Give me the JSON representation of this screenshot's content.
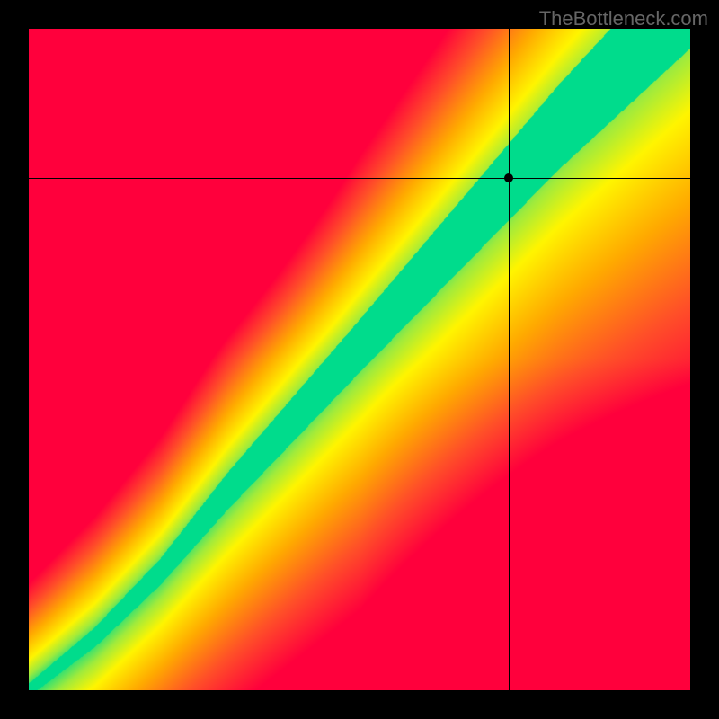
{
  "watermark": "TheBottleneck.com",
  "chart_data": {
    "type": "heatmap",
    "title": "",
    "xlabel": "",
    "ylabel": "",
    "xlim": [
      0,
      1
    ],
    "ylim": [
      0,
      1
    ],
    "colormap": "red-yellow-green (bottleneck)",
    "crosshair": {
      "x": 0.725,
      "y": 0.775
    },
    "marker": {
      "x": 0.725,
      "y": 0.775
    },
    "description": "2D heatmap where a curved green ridge (optimal / 0% bottleneck) runs diagonally from bottom-left to top-right, widening toward the top; red at far off-ridge regions, yellow transitional.",
    "ridge_samples": [
      {
        "x": 0.0,
        "y_center": 0.0,
        "half_width": 0.01
      },
      {
        "x": 0.1,
        "y_center": 0.08,
        "half_width": 0.015
      },
      {
        "x": 0.2,
        "y_center": 0.18,
        "half_width": 0.02
      },
      {
        "x": 0.3,
        "y_center": 0.3,
        "half_width": 0.028
      },
      {
        "x": 0.4,
        "y_center": 0.41,
        "half_width": 0.034
      },
      {
        "x": 0.5,
        "y_center": 0.52,
        "half_width": 0.04
      },
      {
        "x": 0.6,
        "y_center": 0.63,
        "half_width": 0.048
      },
      {
        "x": 0.7,
        "y_center": 0.74,
        "half_width": 0.056
      },
      {
        "x": 0.8,
        "y_center": 0.85,
        "half_width": 0.064
      },
      {
        "x": 0.9,
        "y_center": 0.95,
        "half_width": 0.072
      },
      {
        "x": 1.0,
        "y_center": 1.05,
        "half_width": 0.08
      }
    ]
  }
}
